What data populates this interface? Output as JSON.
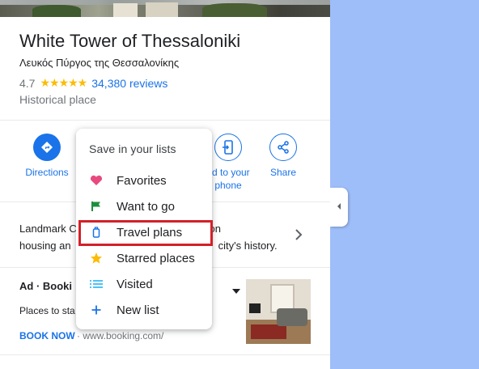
{
  "place": {
    "name": "White Tower of Thessaloniki",
    "native_name": "Λευκός Πύργος της Θεσσαλονίκης",
    "rating": "4.7",
    "stars": "★★★★★",
    "reviews": "34,380 reviews",
    "category": "Historical place"
  },
  "actions": {
    "directions": "Directions",
    "send_to_phone": "Send to your phone",
    "send_to_phone_line1": "nd to your",
    "send_to_phone_line2": "phone",
    "share": "Share"
  },
  "description": {
    "line1_left": "Landmark C",
    "line1_right": "rison",
    "line2_left": "housing an",
    "line2_right": "city's history."
  },
  "ad": {
    "label": "Ad · Booki",
    "text": "Places to sta",
    "cta": "BOOK NOW",
    "url": "· www.booking.com/"
  },
  "save_menu": {
    "header": "Save in your lists",
    "items": [
      {
        "label": "Favorites",
        "icon": "heart-icon",
        "color": "#e8497e"
      },
      {
        "label": "Want to go",
        "icon": "flag-icon",
        "color": "#1e8e3e"
      },
      {
        "label": "Travel plans",
        "icon": "luggage-icon",
        "color": "#1a73e8",
        "highlighted": true
      },
      {
        "label": "Starred places",
        "icon": "star-icon",
        "color": "#fbbc04"
      },
      {
        "label": "Visited",
        "icon": "list-icon",
        "color": "#4fc3f7"
      },
      {
        "label": "New list",
        "icon": "plus-icon",
        "color": "#1a73e8"
      }
    ]
  },
  "colors": {
    "accent": "#1a73e8",
    "map_bg": "#9ebefa",
    "highlight_border": "#d32029"
  }
}
